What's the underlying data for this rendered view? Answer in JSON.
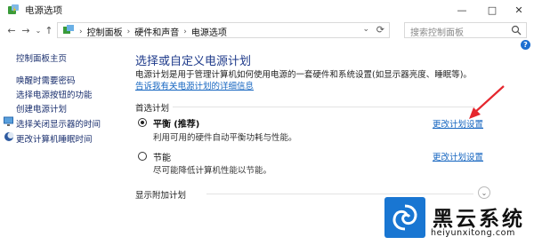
{
  "window": {
    "title": "电源选项",
    "minimize_label": "—",
    "maximize_label": "□",
    "close_label": "✕"
  },
  "nav": {
    "breadcrumbs": [
      "控制面板",
      "硬件和声音",
      "电源选项"
    ],
    "search_placeholder": "搜索控制面板",
    "help_label": "?"
  },
  "sidebar": {
    "home_label": "控制面板主页",
    "items": [
      {
        "label": "唤醒时需要密码"
      },
      {
        "label": "选择电源按钮的功能"
      },
      {
        "label": "创建电源计划"
      },
      {
        "label": "选择关闭显示器的时间",
        "icon": "power-display-icon"
      },
      {
        "label": "更改计算机睡眠时间",
        "icon": "moon-sleep-icon"
      }
    ]
  },
  "main": {
    "heading": "选择或自定义电源计划",
    "description": "电源计划是用于管理计算机如何使用电源的一套硬件和系统设置(如显示器亮度、睡眠等)。",
    "description_link": "告诉我有关电源计划的详细信息",
    "section_label": "首选计划",
    "plans": [
      {
        "name": "平衡",
        "tag": "(推荐)",
        "desc": "利用可用的硬件自动平衡功耗与性能。",
        "link": "更改计划设置",
        "selected": true
      },
      {
        "name": "节能",
        "tag": "",
        "desc": "尽可能降低计算机性能以节能。",
        "link": "更改计划设置",
        "selected": false
      }
    ],
    "show_more": "显示附加计划"
  },
  "watermark": {
    "brand": "黑云系统",
    "domain": "heiyunxitong.com"
  },
  "colors": {
    "link": "#1565c0",
    "heading": "#1e3a8a",
    "arrow": "#e5272e",
    "watermark_bg": "#1976d2"
  }
}
